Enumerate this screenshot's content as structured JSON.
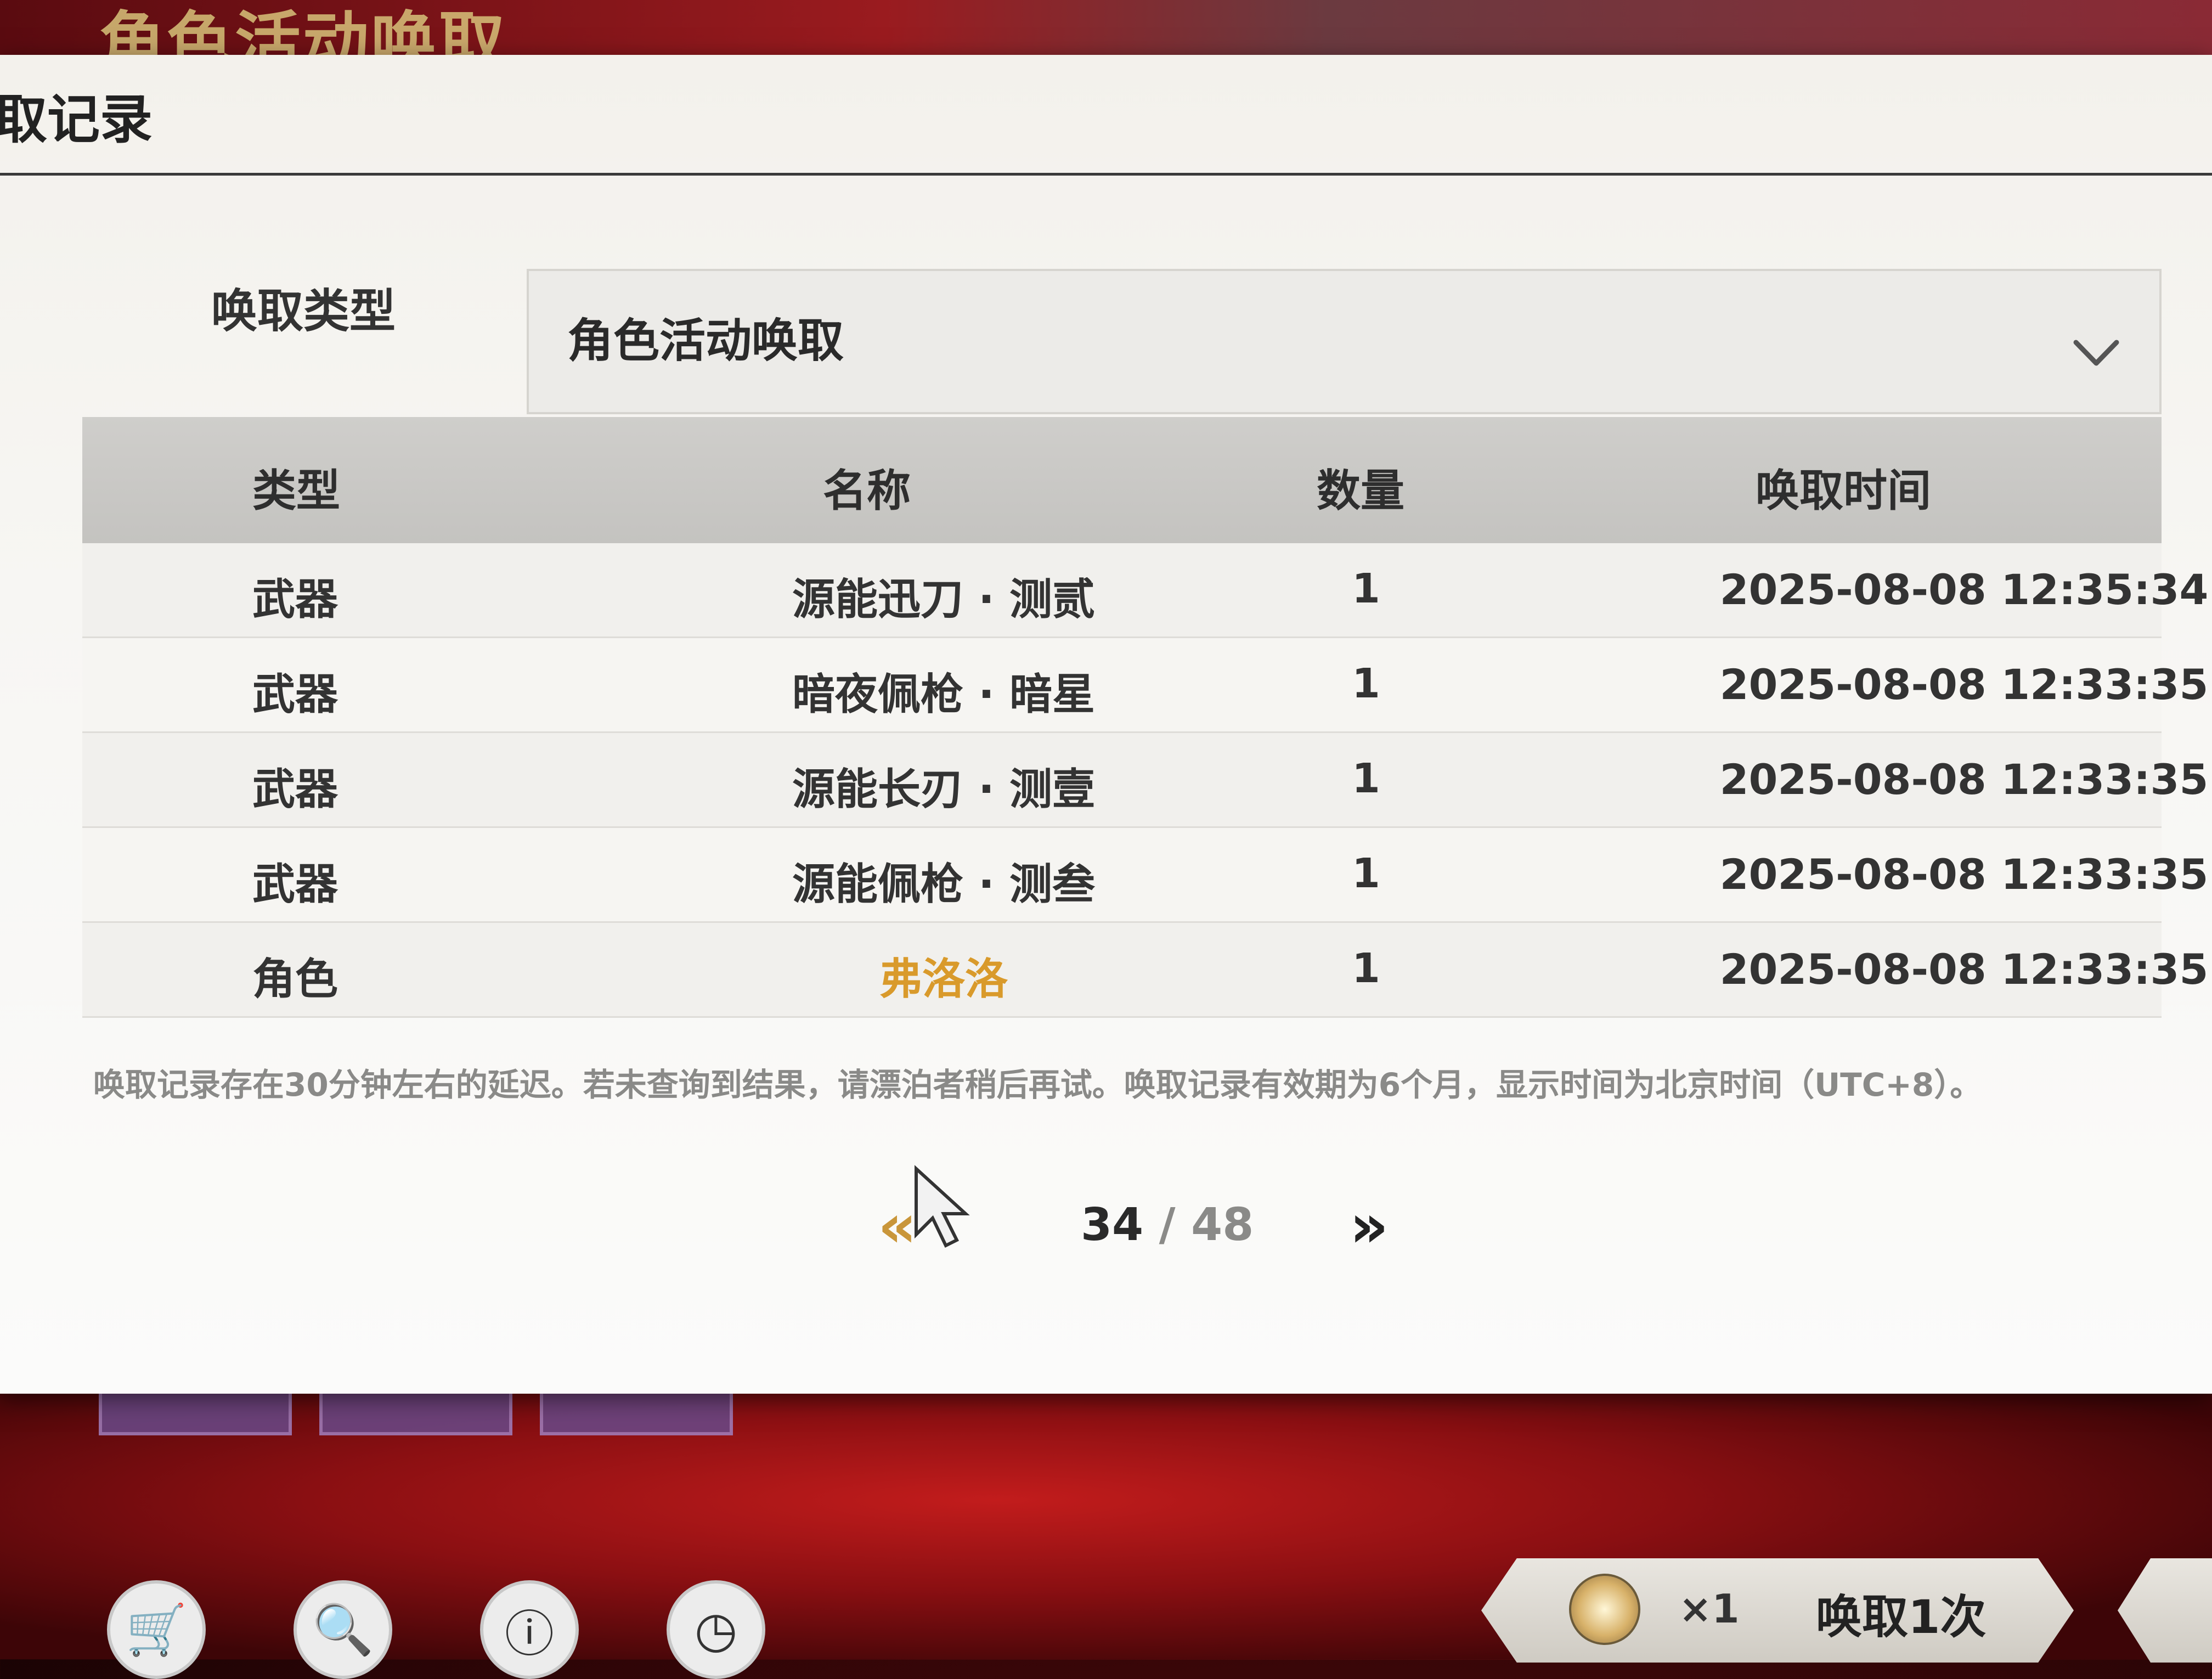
{
  "background": {
    "banner_title": "角色活动唤取"
  },
  "dialog": {
    "title": "取记录",
    "filter": {
      "label": "唤取类型",
      "selected": "角色活动唤取"
    },
    "table": {
      "headers": [
        "类型",
        "名称",
        "数量",
        "唤取时间"
      ],
      "rows": [
        {
          "type": "武器",
          "name": "源能迅刀 · 测贰",
          "qty": "1",
          "time": "2025-08-08 12:35:34"
        },
        {
          "type": "武器",
          "name": "暗夜佩枪 · 暗星",
          "qty": "1",
          "time": "2025-08-08 12:33:35"
        },
        {
          "type": "武器",
          "name": "源能长刃 · 测壹",
          "qty": "1",
          "time": "2025-08-08 12:33:35"
        },
        {
          "type": "武器",
          "name": "源能佩枪 · 测叁",
          "qty": "1",
          "time": "2025-08-08 12:33:35"
        },
        {
          "type": "角色",
          "name": "弗洛洛",
          "qty": "1",
          "time": "2025-08-08 12:33:35"
        }
      ]
    },
    "note": "唤取记录存在30分钟左右的延迟。若未查询到结果，请漂泊者稍后再试。唤取记录有效期为6个月，显示时间为北京时间（UTC+8）。",
    "pager": {
      "prev": "«",
      "current": "34",
      "separator": " / ",
      "total": "48",
      "next": "»"
    }
  },
  "bottom_bar": {
    "icons": [
      "cart-icon",
      "record-search-icon",
      "info-icon",
      "history-icon"
    ],
    "icon_glyphs": [
      "🛒",
      "🔍",
      "ⓘ",
      "◷"
    ],
    "summon_count": "×1",
    "summon_label": "唤取1次"
  },
  "colors": {
    "highlight_name": "#d99a2b",
    "pager_prev": "#c9963a"
  }
}
